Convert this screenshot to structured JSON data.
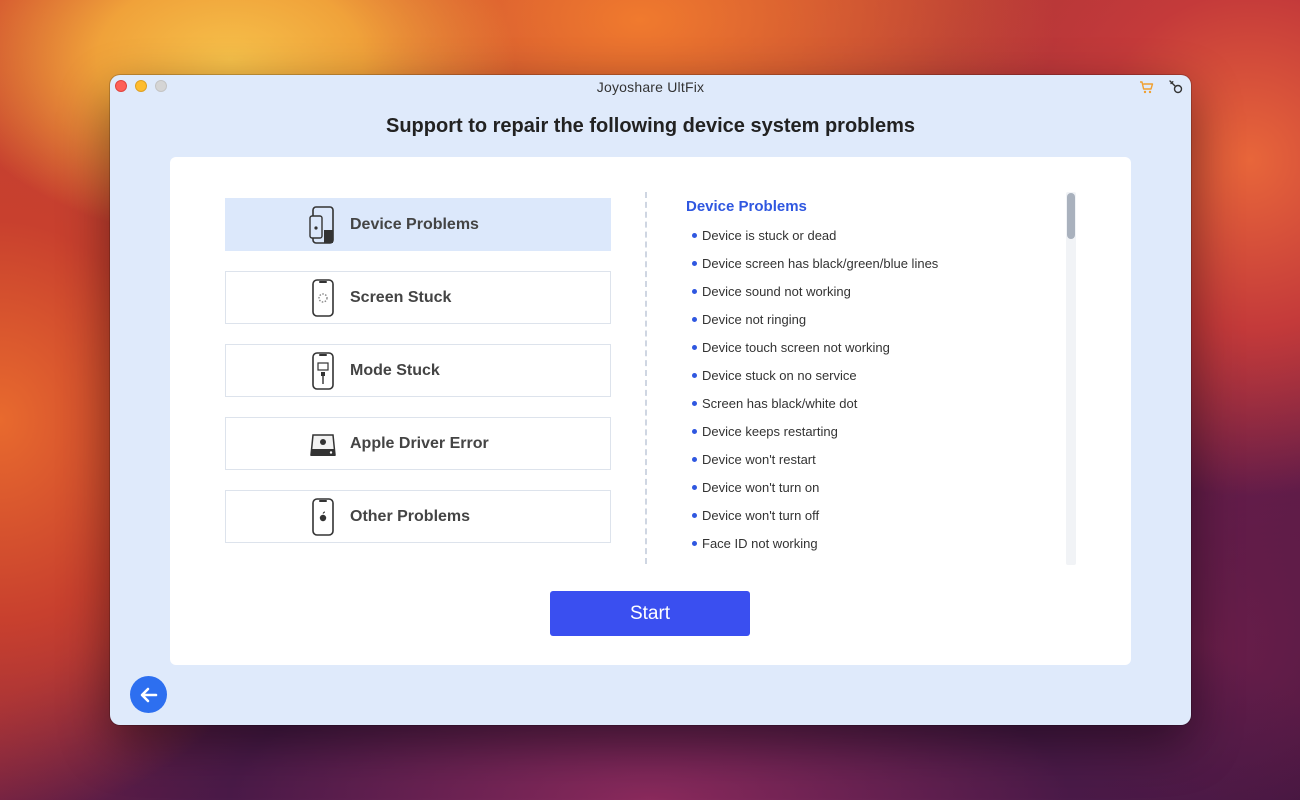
{
  "window": {
    "title": "Joyoshare UltFix"
  },
  "heading": "Support to repair the following device system problems",
  "categories": [
    {
      "label": "Device Problems",
      "icon": "phone-icon",
      "active": true
    },
    {
      "label": "Screen Stuck",
      "icon": "phone-loading-icon",
      "active": false
    },
    {
      "label": "Mode Stuck",
      "icon": "phone-cable-icon",
      "active": false
    },
    {
      "label": "Apple Driver Error",
      "icon": "drive-icon",
      "active": false
    },
    {
      "label": "Other Problems",
      "icon": "phone-apple-icon",
      "active": false
    }
  ],
  "problems": {
    "title": "Device Problems",
    "items": [
      "Device is stuck or dead",
      "Device screen has black/green/blue lines",
      "Device sound not working",
      "Device not ringing",
      "Device touch screen not working",
      "Device stuck on no service",
      "Screen has black/white dot",
      "Device keeps restarting",
      "Device won't restart",
      "Device won't turn on",
      "Device won't turn off",
      "Face ID not working"
    ]
  },
  "start_label": "Start",
  "colors": {
    "accent": "#3a4ff0",
    "link": "#2f57e0",
    "active_bg": "#dce8fb"
  }
}
